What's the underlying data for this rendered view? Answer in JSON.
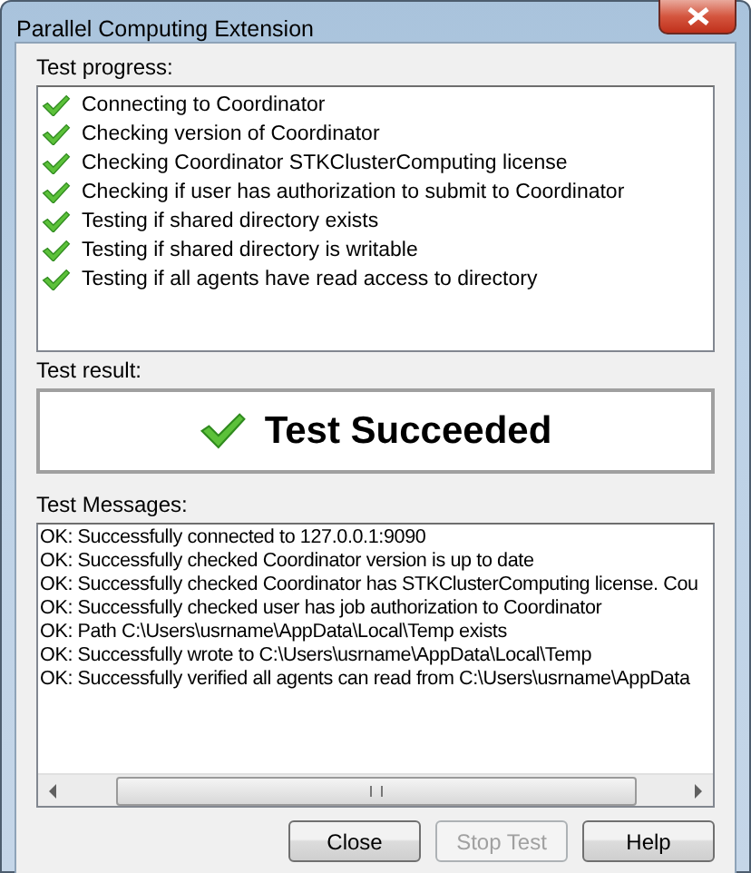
{
  "window": {
    "title": "Parallel Computing Extension"
  },
  "progress": {
    "label": "Test progress:",
    "items": [
      {
        "text": "Connecting to Coordinator",
        "done": true
      },
      {
        "text": "Checking version of Coordinator",
        "done": true
      },
      {
        "text": "Checking Coordinator STKClusterComputing license",
        "done": true
      },
      {
        "text": "Checking if user has authorization to submit to Coordinator",
        "done": true
      },
      {
        "text": "Testing if shared directory exists",
        "done": true
      },
      {
        "text": "Testing if shared directory is writable",
        "done": true
      },
      {
        "text": "Testing if all agents have read access to directory",
        "done": true
      }
    ]
  },
  "result": {
    "label": "Test result:",
    "text": "Test Succeeded",
    "success": true
  },
  "messages": {
    "label": "Test Messages:",
    "lines": [
      "OK: Successfully connected to 127.0.0.1:9090",
      "OK: Successfully checked Coordinator version is up to date",
      "OK: Successfully checked Coordinator has STKClusterComputing license. Cou",
      "OK: Successfully checked user has job authorization to Coordinator",
      "OK: Path C:\\Users\\usrname\\AppData\\Local\\Temp exists",
      "OK: Successfully wrote to C:\\Users\\usrname\\AppData\\Local\\Temp",
      "OK: Successfully verified all agents can read from C:\\Users\\usrname\\AppData"
    ]
  },
  "buttons": [
    {
      "label": "Close",
      "disabled": false
    },
    {
      "label": "Stop Test",
      "disabled": true
    },
    {
      "label": "Help",
      "disabled": false
    }
  ]
}
